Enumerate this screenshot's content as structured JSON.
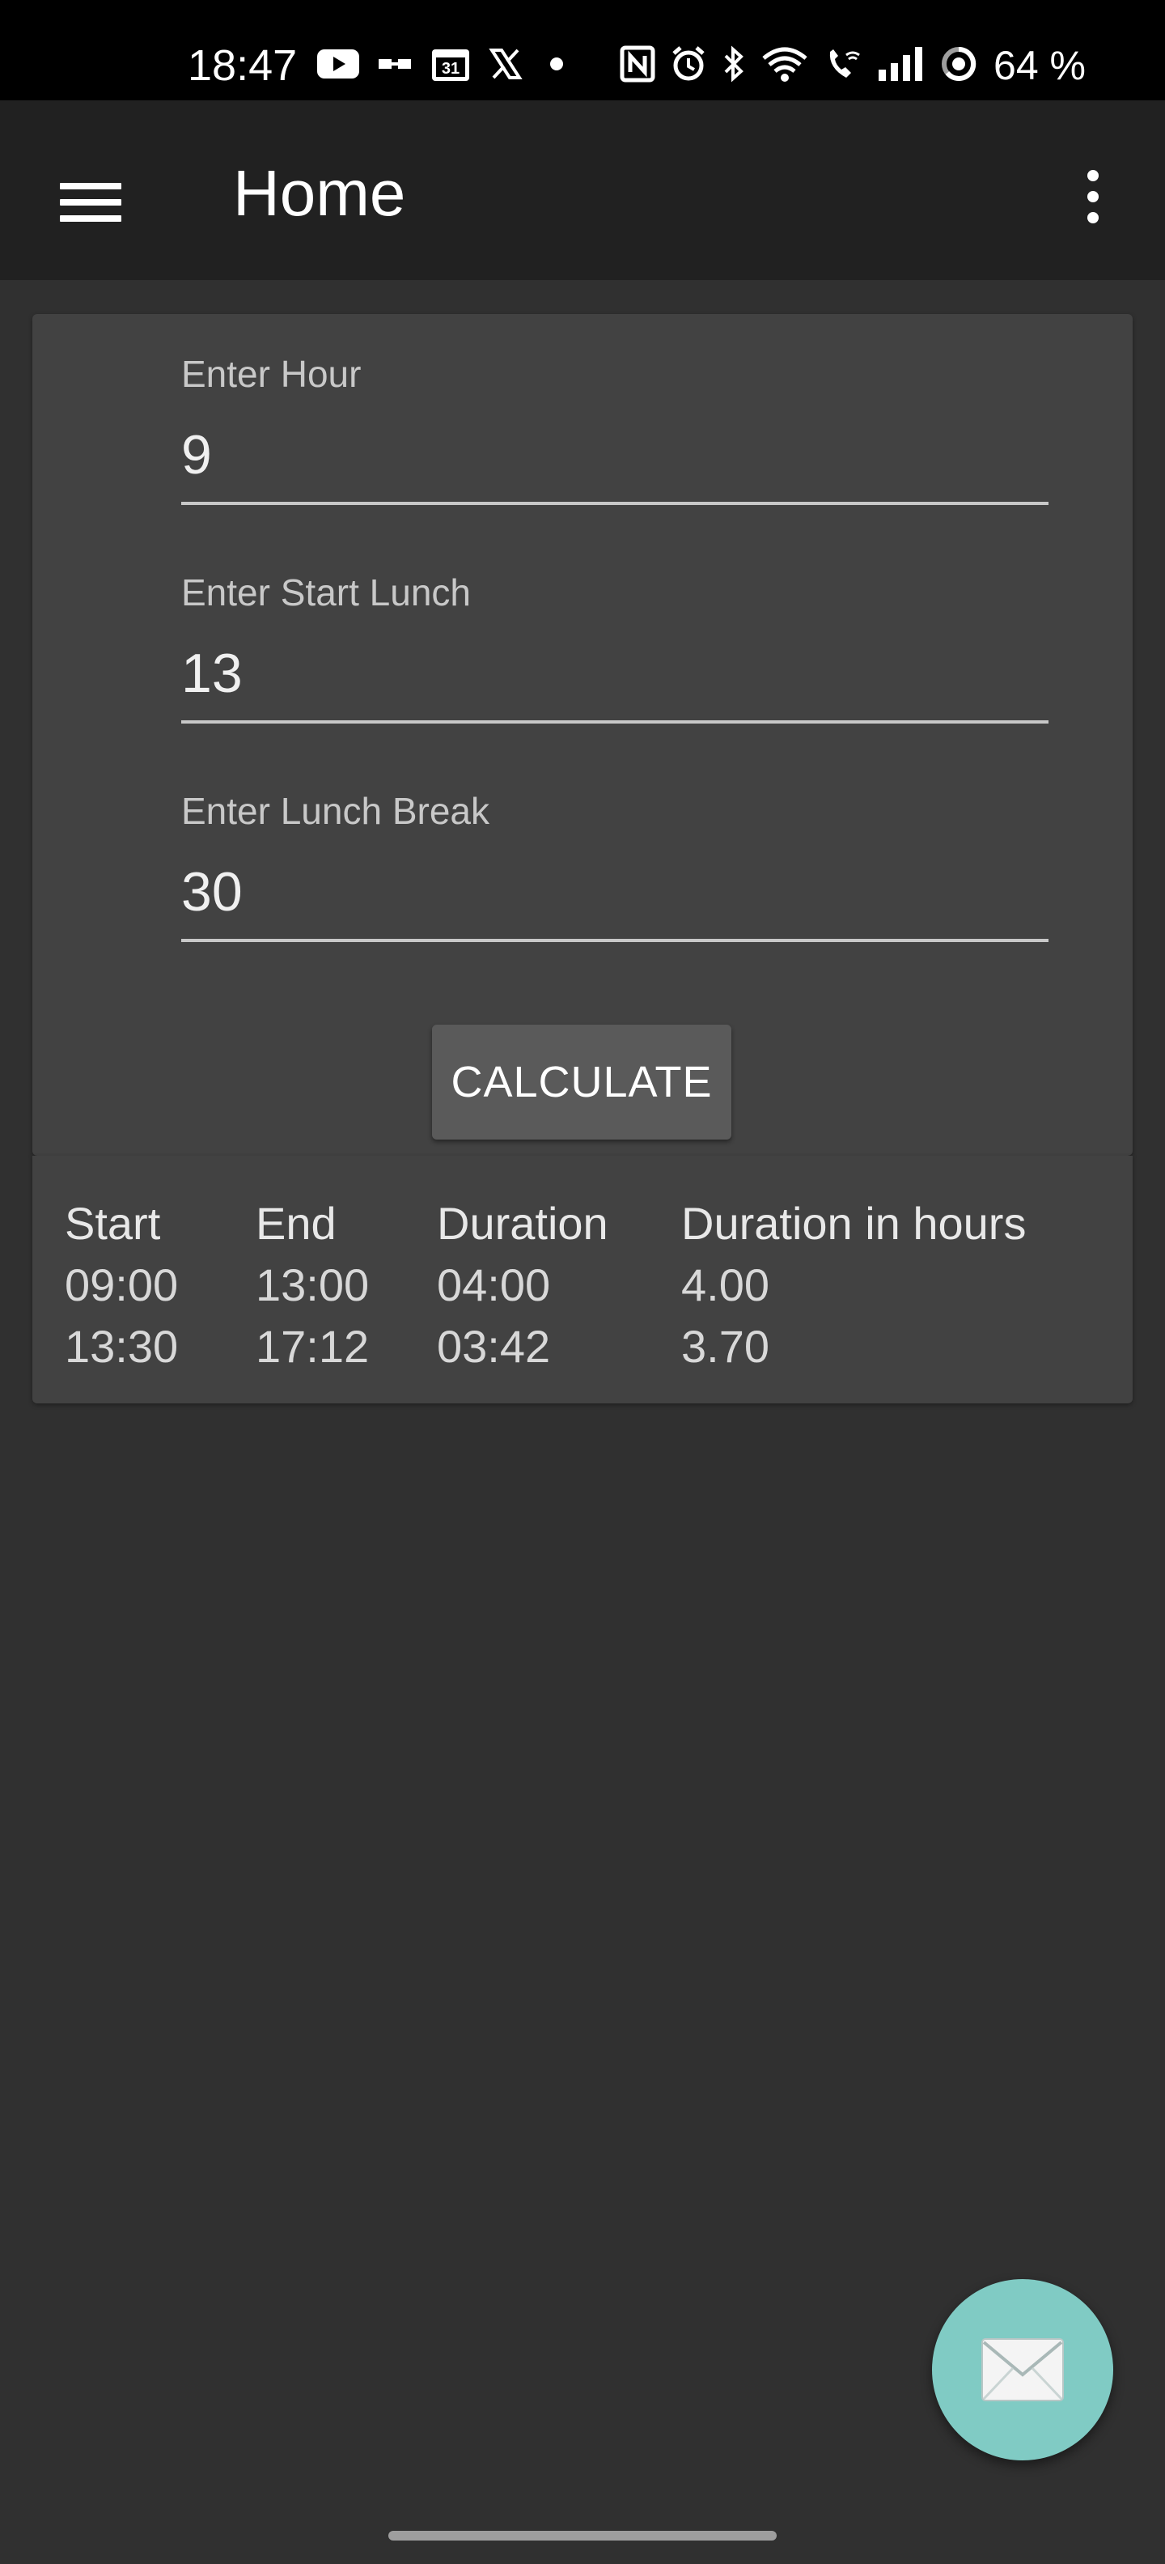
{
  "status_bar": {
    "time": "18:47",
    "calendar_day": "31",
    "battery_percent": "64 %",
    "icons": [
      "youtube-icon",
      "voicemail-icon",
      "calendar-icon",
      "x-icon",
      "notification-dot-icon",
      "nfc-icon",
      "alarm-icon",
      "bluetooth-icon",
      "wifi-icon",
      "wifi-calling-icon",
      "signal-icon",
      "battery-icon"
    ]
  },
  "app_bar": {
    "title": "Home",
    "menu_icon": "hamburger-menu-icon",
    "overflow_icon": "more-vert-icon"
  },
  "form": {
    "hour": {
      "label": "Enter Hour",
      "value": "9"
    },
    "start_lunch": {
      "label": "Enter Start Lunch",
      "value": "13"
    },
    "lunch_break": {
      "label": "Enter Lunch Break",
      "value": "30"
    },
    "calculate_label": "CALCULATE"
  },
  "results": {
    "columns": [
      "Start",
      "End",
      "Duration",
      "Duration in hours"
    ],
    "rows": [
      [
        "09:00",
        "13:00",
        "04:00",
        "4.00"
      ],
      [
        "13:30",
        "17:12",
        "03:42",
        "3.70"
      ]
    ]
  },
  "fab": {
    "icon": "envelope-icon",
    "color": "#80cbc4"
  },
  "colors": {
    "background": "#303030",
    "app_bar": "#212121",
    "card": "#424242",
    "button": "#5a5a5a",
    "accent": "#80cbc4"
  }
}
